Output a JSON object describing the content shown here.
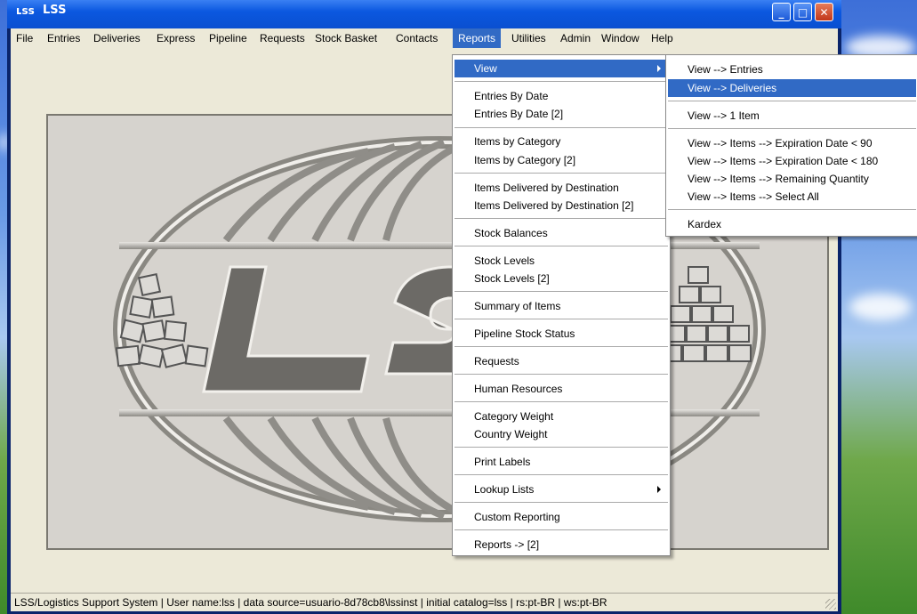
{
  "window": {
    "title": "LSS",
    "logo_glyph": "LSS"
  },
  "menubar": [
    "File",
    "Entries",
    "Deliveries",
    "Express",
    "Pipeline",
    "Requests",
    "Stock Basket",
    "Contacts",
    "Reports",
    "Utilities",
    "Admin",
    "Window",
    "Help"
  ],
  "reports_menu": {
    "items": [
      {
        "label": "View",
        "submenu": true
      },
      {
        "label": "Entries By Date"
      },
      {
        "label": "Entries By Date [2]"
      },
      {
        "label": "Items by Category"
      },
      {
        "label": "Items by Category [2]"
      },
      {
        "label": "Items Delivered by Destination"
      },
      {
        "label": "Items Delivered by Destination [2]"
      },
      {
        "label": "Stock Balances"
      },
      {
        "label": "Stock Levels"
      },
      {
        "label": "Stock Levels [2]"
      },
      {
        "label": "Summary of Items"
      },
      {
        "label": "Pipeline Stock Status"
      },
      {
        "label": "Requests"
      },
      {
        "label": "Human Resources"
      },
      {
        "label": "Category Weight"
      },
      {
        "label": "Country Weight"
      },
      {
        "label": "Print Labels"
      },
      {
        "label": "Lookup Lists",
        "submenu": true
      },
      {
        "label": "Custom Reporting"
      },
      {
        "label": "Reports -> [2]"
      }
    ]
  },
  "view_submenu": {
    "items": [
      {
        "label": "View --> Entries"
      },
      {
        "label": "View --> Deliveries"
      },
      {
        "label": "View -->  1 Item"
      },
      {
        "label": "View --> Items --> Expiration Date < 90"
      },
      {
        "label": "View --> Items --> Expiration Date < 180"
      },
      {
        "label": "View --> Items --> Remaining Quantity"
      },
      {
        "label": "View --> Items --> Select All"
      },
      {
        "label": "Kardex"
      }
    ]
  },
  "statusbar": {
    "text": "LSS/Logistics Support System | User name:lss | data source=usuario-8d78cb8\\lssinst | initial catalog=lss | rs:pt-BR | ws:pt-BR"
  },
  "colors": {
    "menu_highlight": "#316ac5",
    "client_bg": "#ece9d8",
    "logo_panel_bg": "#d6d3ce"
  },
  "icons": [
    "minimize-icon",
    "maximize-icon",
    "close-icon",
    "submenu-arrow-icon",
    "size-grip-icon"
  ]
}
